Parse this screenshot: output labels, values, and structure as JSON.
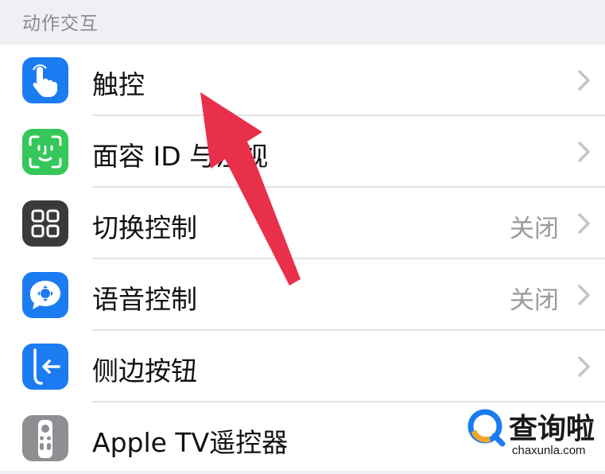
{
  "section": {
    "title": "动作交互"
  },
  "rows": [
    {
      "label": "触控",
      "value": "",
      "icon": "touch-hand-icon",
      "icon_color": "#1b7cf2"
    },
    {
      "label": "面容 ID 与注视",
      "value": "",
      "icon": "face-id-icon",
      "icon_color": "#35c759"
    },
    {
      "label": "切换控制",
      "value": "",
      "icon": "switch-control-icon",
      "icon_color": "#3a3a3c",
      "value_text": "关闭"
    },
    {
      "label": "语音控制",
      "value": "关闭",
      "icon": "voice-control-icon",
      "icon_color": "#1b7cf2"
    },
    {
      "label": "侧边按钮",
      "value": "",
      "icon": "side-button-icon",
      "icon_color": "#1b7cf2"
    },
    {
      "label": "Apple TV遥控器",
      "value": "",
      "icon": "apple-tv-remote-icon",
      "icon_color": "#8e8e93"
    }
  ],
  "switch_value": "关闭",
  "watermark": {
    "name": "查询啦",
    "domain": "chaxunla.com"
  },
  "colors": {
    "annotation_arrow": "#e8304a",
    "background": "#efeff4",
    "chevron": "#c4c4c8"
  }
}
